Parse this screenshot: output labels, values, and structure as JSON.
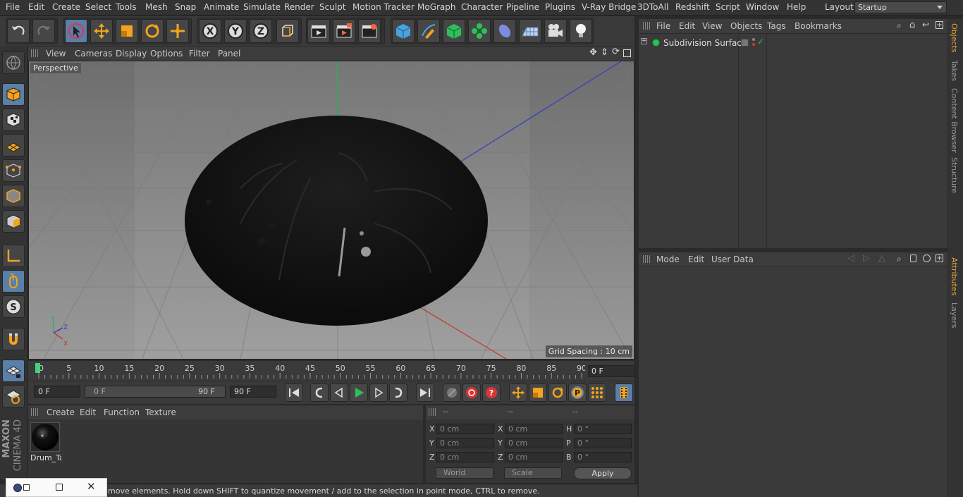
{
  "menubar": {
    "items": [
      "File",
      "Edit",
      "Create",
      "Select",
      "Tools",
      "Mesh",
      "Snap",
      "Animate",
      "Simulate",
      "Render",
      "Sculpt",
      "Motion Tracker",
      "MoGraph",
      "Character",
      "Pipeline",
      "Plugins",
      "V-Ray Bridge",
      "3DToAll",
      "Redshift",
      "Script",
      "Window",
      "Help"
    ],
    "layout_label": "Layout:",
    "layout_value": "Startup"
  },
  "viewport": {
    "menu": [
      "View",
      "Cameras",
      "Display",
      "Options",
      "Filter",
      "Panel"
    ],
    "label": "Perspective",
    "grid_spacing": "Grid Spacing : 10 cm"
  },
  "timeline": {
    "ticks": [
      "0",
      "5",
      "10",
      "15",
      "20",
      "25",
      "30",
      "35",
      "40",
      "45",
      "50",
      "55",
      "60",
      "65",
      "70",
      "75",
      "80",
      "85",
      "90"
    ],
    "current_frame": "0 F"
  },
  "transport": {
    "start_field": "0 F",
    "range_start": "0 F",
    "range_end": "90 F",
    "end_field": "90 F"
  },
  "materials": {
    "menu": [
      "Create",
      "Edit",
      "Function",
      "Texture"
    ],
    "items": [
      {
        "name": "Drum_Ta"
      }
    ]
  },
  "coordinates": {
    "headers": [
      "--",
      "--",
      "--"
    ],
    "rows": [
      {
        "l1": "X",
        "v1": "0 cm",
        "l2": "X",
        "v2": "0 cm",
        "l3": "H",
        "v3": "0 °"
      },
      {
        "l1": "Y",
        "v1": "0 cm",
        "l2": "Y",
        "v2": "0 cm",
        "l3": "P",
        "v3": "0 °"
      },
      {
        "l1": "Z",
        "v1": "0 cm",
        "l2": "Z",
        "v2": "0 cm",
        "l3": "B",
        "v3": "0 °"
      }
    ],
    "mode_world": "World",
    "mode_scale": "Scale",
    "apply_label": "Apply"
  },
  "status": {
    "text": "move elements. Hold down SHIFT to quantize movement / add to the selection in point mode, CTRL to remove."
  },
  "object_manager": {
    "menu": [
      "File",
      "Edit",
      "View",
      "Objects",
      "Tags",
      "Bookmarks"
    ],
    "objects": [
      {
        "name": "Subdivision Surface"
      }
    ]
  },
  "attribute_manager": {
    "menu": [
      "Mode",
      "Edit",
      "User Data"
    ]
  },
  "side_tabs": [
    "Objects",
    "Takes",
    "Content Browser",
    "Structure",
    "Attributes",
    "Layers"
  ],
  "logo": {
    "brand": "MAXON",
    "product": "CINEMA 4D"
  },
  "colors": {
    "accent_blue": "#5a7fa8",
    "tab_active": "#e6a53a",
    "axis_x": "#c0392b",
    "axis_y": "#27ae60",
    "axis_z": "#3040c0"
  }
}
